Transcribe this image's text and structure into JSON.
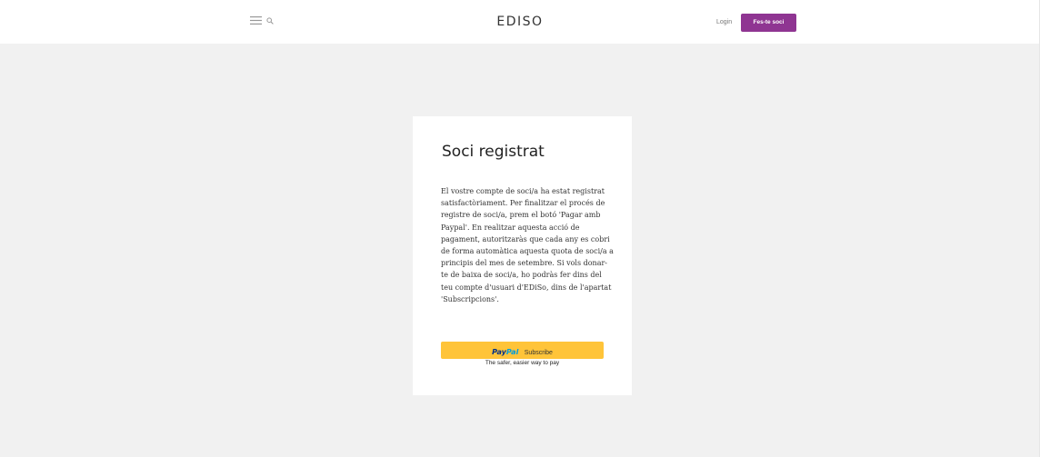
{
  "header": {
    "site_title": "EDISO",
    "login_label": "Login",
    "join_label": "Fes-te soci",
    "menu_icon": "hamburger-menu-icon",
    "search_icon": "search-icon",
    "accent_color": "#8f3592"
  },
  "card": {
    "title": "Soci registrat",
    "body": "El vostre compte de soci/a ha estat registrat satisfactòriament. Per finalitzar el procés de registre de soci/a, prem el botó 'Pagar amb Paypal'. En realitzar aquesta acció de pagament, autoritzaràs que cada any es cobri de forma automàtica aquesta quota de soci/a a principis del mes de setembre. Si vols donar-te de baixa de soci/a, ho podràs fer dins del teu compte d'usuari d'EDiSo, dins de l'apartat 'Subscripcions'.",
    "paypal": {
      "logo_pay": "Pay",
      "logo_pal": "Pal",
      "button_label": "Subscribe",
      "tagline": "The safer, easier way to pay",
      "button_color": "#ffc439"
    }
  }
}
